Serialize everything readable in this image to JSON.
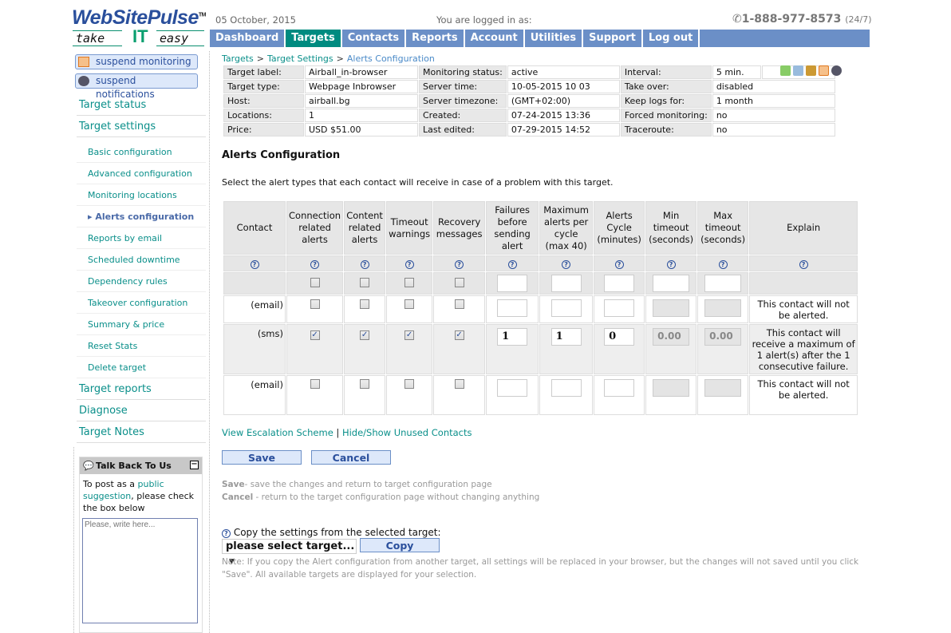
{
  "logo": {
    "name": "WebSitePulse",
    "tagline_take": "take",
    "tagline_it": "IT",
    "tagline_easy": "easy",
    "tm": "TM"
  },
  "header": {
    "date": "05 October, 2015",
    "logged_in": "You are logged in as:",
    "phone": "1-888-977-8573",
    "phone_hours": "(24/7)"
  },
  "nav": [
    {
      "label": "Dashboard"
    },
    {
      "label": "Targets",
      "active": true
    },
    {
      "label": "Contacts"
    },
    {
      "label": "Reports"
    },
    {
      "label": "Account"
    },
    {
      "label": "Utilities"
    },
    {
      "label": "Support"
    },
    {
      "label": "Log out"
    }
  ],
  "sidebar": {
    "suspend_monitoring": "suspend monitoring",
    "suspend_notifications": "suspend notifications",
    "target_status": "Target status",
    "target_settings": "Target settings",
    "sub": [
      "Basic configuration",
      "Advanced configuration",
      "Monitoring locations",
      "Alerts configuration",
      "Reports by email",
      "Scheduled downtime",
      "Dependency rules",
      "Takeover configuration",
      "Summary & price",
      "Reset Stats",
      "Delete target"
    ],
    "after": [
      "Target reports",
      "Diagnose",
      "Target Notes"
    ],
    "talk": {
      "title": "Talk Back To Us",
      "text1": "To post as a ",
      "link": "public suggestion",
      "text2": ", please check the box below",
      "placeholder": "Please, write here..."
    }
  },
  "breadcrumb": [
    "Targets",
    "Target Settings",
    "Alerts Configuration"
  ],
  "info": [
    [
      "Target label:",
      "Airball_in-browser",
      "Monitoring status:",
      "active",
      "Interval:",
      "5 min."
    ],
    [
      "Target type:",
      "Webpage Inbrowser",
      "Server time:",
      "10-05-2015 10 03",
      "Take over:",
      "disabled"
    ],
    [
      "Host:",
      "airball.bg",
      "Server timezone:",
      "(GMT+02:00)",
      "Keep logs for:",
      "1 month"
    ],
    [
      "Locations:",
      "1",
      "Created:",
      "07-24-2015 13:36",
      "Forced monitoring:",
      "no"
    ],
    [
      "Price:",
      "USD $51.00",
      "Last edited:",
      "07-29-2015 14:52",
      "Traceroute:",
      "no"
    ]
  ],
  "title": "Alerts Configuration",
  "intro": "Select the alert types that each contact will receive in case of a problem with this target.",
  "table": {
    "headers": [
      "Contact",
      "Connection related alerts",
      "Content related alerts",
      "Timeout warnings",
      "Recovery messages",
      "Failures before sending alert",
      "Maximum alerts per cycle (max 40)",
      "Alerts Cycle (minutes)",
      "Min timeout (seconds)",
      "Max timeout (seconds)",
      "Explain"
    ],
    "rows": [
      {
        "contact": "(email)",
        "checks": [
          false,
          false,
          false,
          false
        ],
        "failures": "",
        "max": "",
        "cycle": "",
        "min": "",
        "maxt": "",
        "explain": "This contact will not be alerted."
      },
      {
        "contact": "(sms)",
        "checks": [
          true,
          true,
          true,
          true
        ],
        "failures": "1",
        "max": "1",
        "cycle": "0",
        "min": "0.00",
        "maxt": "0.00",
        "explain": "This contact will receive a maximum of 1 alert(s) after the 1 consecutive failure."
      },
      {
        "contact": "(email)",
        "checks": [
          false,
          false,
          false,
          false
        ],
        "failures": "",
        "max": "",
        "cycle": "",
        "min": "",
        "maxt": "",
        "explain": "This contact will not be alerted."
      }
    ]
  },
  "links": {
    "escalation": "View Escalation Scheme",
    "sep": "|",
    "hide_show": "Hide/Show Unused Contacts"
  },
  "buttons": {
    "save": "Save",
    "cancel": "Cancel",
    "copy": "Copy"
  },
  "help": {
    "save_b": "Save",
    "save_t": "- save the changes and return to target configuration page",
    "cancel_b": "Cancel",
    "cancel_t": " - return to the target configuration page without changing anything"
  },
  "copy": {
    "label": "Copy the settings from the selected target:",
    "select": "please select target...",
    "note": "Note: If you copy the Alert configuration from another target, all settings will be replaced in your browser, but the changes will not saved until you click \"Save\". All available targets are displayed for your selection."
  }
}
